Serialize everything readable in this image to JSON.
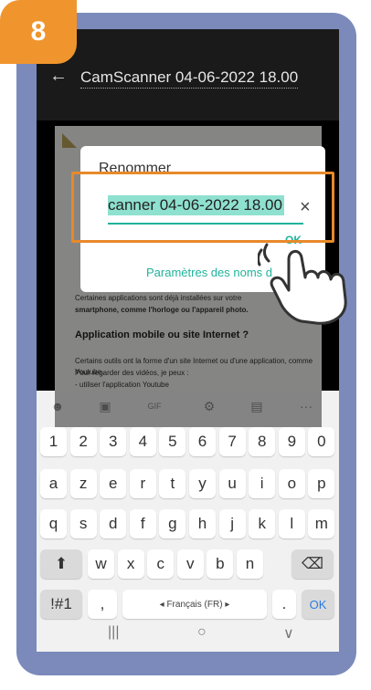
{
  "step": {
    "number": "8"
  },
  "header": {
    "back_icon": "arrow-left",
    "title": "CamScanner 04-06-2022 18.00"
  },
  "document": {
    "lines": [
      "Certaines applications sont déjà installées sur votre",
      "smartphone, comme l'horloge ou l'appareil photo."
    ],
    "heading": "Application mobile ou site Internet ?",
    "lines2": [
      "Certains outils ont la forme d'un site Internet ou d'une application, comme Youtube.",
      "Pour regarder des vidéos, je peux :",
      "-  utiliser l'application Youtube"
    ]
  },
  "dialog": {
    "title": "Renommer",
    "input_value": "canner 04-06-2022 18.00",
    "clear_icon": "close",
    "ok_label": "OK",
    "settings_link": "Paramètres des noms d"
  },
  "keyboard": {
    "toolbar": [
      "emoji",
      "sticker",
      "GIF",
      "settings",
      "clipboard",
      "more"
    ],
    "row1": [
      "1",
      "2",
      "3",
      "4",
      "5",
      "6",
      "7",
      "8",
      "9",
      "0"
    ],
    "row2": [
      "a",
      "z",
      "e",
      "r",
      "t",
      "y",
      "u",
      "i",
      "o",
      "p"
    ],
    "row3": [
      "q",
      "s",
      "d",
      "f",
      "g",
      "h",
      "j",
      "k",
      "l",
      "m"
    ],
    "row4": [
      "w",
      "x",
      "c",
      "v",
      "b",
      "n"
    ],
    "symbols_key": "!#1",
    "comma_key": ",",
    "space_label": "◂ Français (FR) ▸",
    "period_key": ".",
    "ok_key": "OK"
  },
  "colors": {
    "frame": "#7B8ABB",
    "badge": "#F0952D",
    "accent": "#20b39b",
    "highlight": "#E8892A"
  }
}
